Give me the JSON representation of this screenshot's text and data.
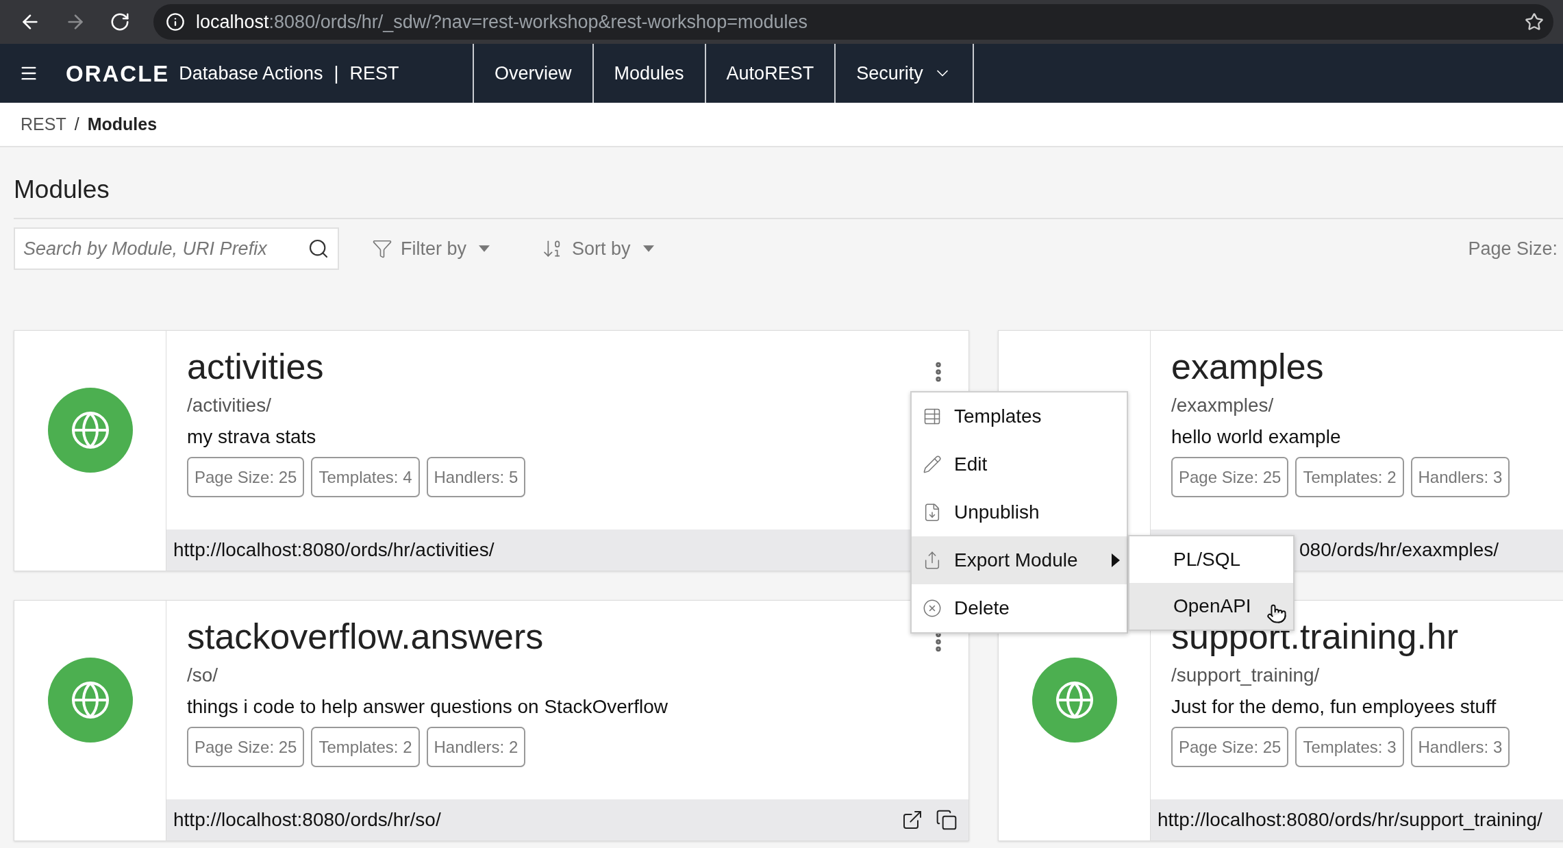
{
  "browser": {
    "url_host": "localhost",
    "url_rest": ":8080/ords/hr/_sdw/?nav=rest-workshop&rest-workshop=modules"
  },
  "app_bar": {
    "brand": "ORACLE",
    "product": "Database Actions",
    "separator": "|",
    "section": "REST",
    "nav": [
      {
        "label": "Overview",
        "kind": "link"
      },
      {
        "label": "Modules",
        "kind": "link"
      },
      {
        "label": "AutoREST",
        "kind": "link"
      },
      {
        "label": "Security",
        "kind": "dropdown"
      }
    ]
  },
  "breadcrumb": {
    "items": [
      "REST",
      "Modules"
    ],
    "separator": "/"
  },
  "page_title": "Modules",
  "toolbar": {
    "search_placeholder": "Search by Module, URI Prefix",
    "filter": "Filter by",
    "sort": "Sort by",
    "page_size_label": "Page Size:"
  },
  "cards": [
    {
      "name": "activities",
      "uri": "/activities/",
      "description": "my strava stats",
      "badges": [
        "Page Size: 25",
        "Templates: 4",
        "Handlers: 5"
      ],
      "url": "http://localhost:8080/ords/hr/activities/",
      "globe": true,
      "menu_button": true,
      "url_actions": false,
      "url_offset": false
    },
    {
      "name": "examples",
      "uri": "/exaxmples/",
      "description": "hello world example",
      "badges": [
        "Page Size: 25",
        "Templates: 2",
        "Handlers: 3"
      ],
      "url": "080/ords/hr/exaxmples/",
      "globe": false,
      "menu_button": false,
      "url_actions": false,
      "url_offset": true
    },
    {
      "name": "stackoverflow.answers",
      "uri": "/so/",
      "description": "things i code to help answer questions on StackOverflow",
      "badges": [
        "Page Size: 25",
        "Templates: 2",
        "Handlers: 2"
      ],
      "url": "http://localhost:8080/ords/hr/so/",
      "globe": true,
      "menu_button": true,
      "url_actions": true,
      "url_offset": false
    },
    {
      "name": "support.training.hr",
      "uri": "/support_training/",
      "description": "Just for the demo, fun employees stuff",
      "badges": [
        "Page Size: 25",
        "Templates: 3",
        "Handlers: 3"
      ],
      "url": "http://localhost:8080/ords/hr/support_training/",
      "globe": true,
      "menu_button": false,
      "url_actions": false,
      "url_offset": false
    }
  ],
  "context_menu": {
    "items": [
      {
        "label": "Templates",
        "kind": "templates",
        "highlighted": false
      },
      {
        "label": "Edit",
        "kind": "edit",
        "highlighted": false
      },
      {
        "label": "Unpublish",
        "kind": "unpublish",
        "highlighted": false
      },
      {
        "label": "Export Module",
        "kind": "export",
        "highlighted": true
      },
      {
        "label": "Delete",
        "kind": "delete",
        "highlighted": false
      }
    ],
    "submenu": [
      {
        "label": "PL/SQL",
        "highlighted": false
      },
      {
        "label": "OpenAPI",
        "highlighted": true
      }
    ]
  }
}
